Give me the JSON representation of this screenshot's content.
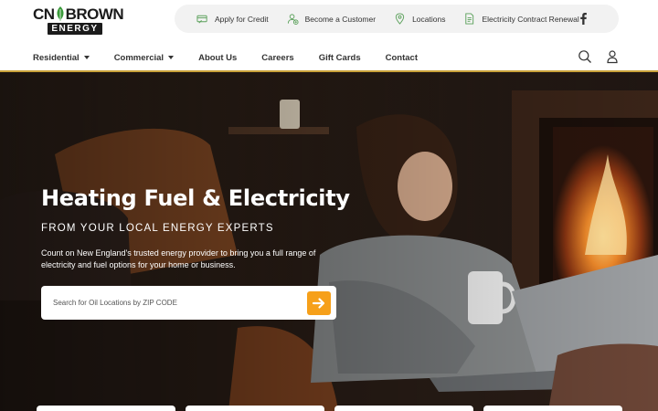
{
  "brand": {
    "logo_top_left": "CN",
    "logo_top_right": "BROWN",
    "logo_bottom": "ENERGY",
    "accent": "#f6a01a",
    "gold": "#c9a23a",
    "green": "#3a9a3a"
  },
  "utility_nav": [
    {
      "label": "Apply for Credit",
      "icon": "credit-card-icon"
    },
    {
      "label": "Become a Customer",
      "icon": "add-user-icon"
    },
    {
      "label": "Locations",
      "icon": "map-pin-icon"
    },
    {
      "label": "Electricity Contract Renewal",
      "icon": "document-icon"
    }
  ],
  "social": {
    "icon": "facebook-icon"
  },
  "main_nav": [
    {
      "label": "Residential",
      "dropdown": true
    },
    {
      "label": "Commercial",
      "dropdown": true
    },
    {
      "label": "About Us",
      "dropdown": false
    },
    {
      "label": "Careers",
      "dropdown": false
    },
    {
      "label": "Gift Cards",
      "dropdown": false
    },
    {
      "label": "Contact",
      "dropdown": false
    }
  ],
  "nav_icons": [
    "search-icon",
    "user-icon"
  ],
  "hero": {
    "title": "Heating Fuel & Electricity",
    "subtitle": "FROM YOUR LOCAL ENERGY EXPERTS",
    "description": "Count on New England's trusted energy provider to bring you a full range of electricity and fuel options for your home or business."
  },
  "search": {
    "placeholder": "Search for Oil Locations by ZIP CODE",
    "button_icon": "arrow-right-icon"
  }
}
